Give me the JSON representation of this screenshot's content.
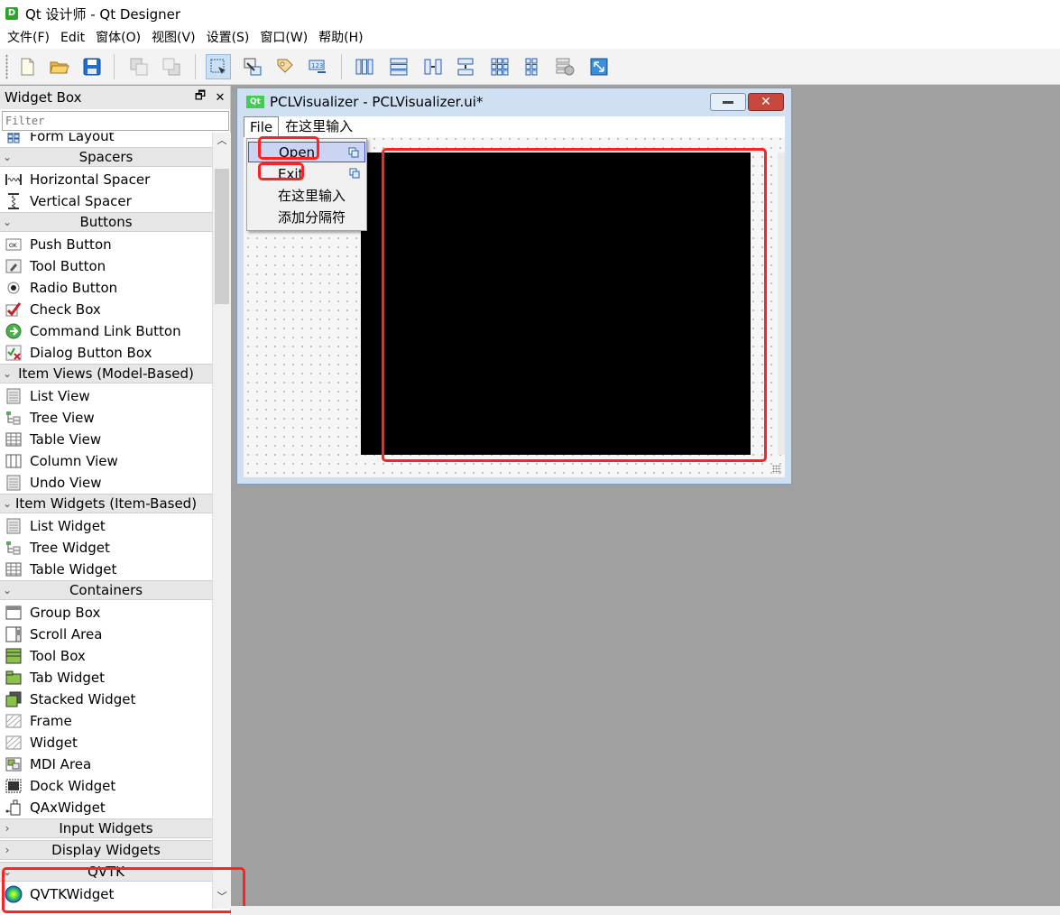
{
  "window": {
    "title": "Qt 设计师 - Qt Designer",
    "app_icon": "D"
  },
  "menubar": {
    "items": [
      "文件(F)",
      "Edit",
      "窗体(O)",
      "视图(V)",
      "设置(S)",
      "窗口(W)",
      "帮助(H)"
    ]
  },
  "toolbar": {
    "buttons": [
      "new-file-icon",
      "open-folder-icon",
      "save-icon",
      "send-to-back-icon",
      "bring-to-front-icon",
      "edit-widgets-icon",
      "edit-signals-slots-icon",
      "edit-buddies-icon",
      "edit-tab-order-icon",
      "layout-horizontal-icon",
      "layout-vertical-icon",
      "layout-splitter-h-icon",
      "layout-splitter-v-icon",
      "layout-grid-icon",
      "layout-form-icon",
      "break-layout-icon",
      "adjust-size-icon"
    ]
  },
  "widget_box": {
    "title": "Widget Box",
    "filter_placeholder": "Filter",
    "rows": [
      {
        "type": "item",
        "label": "Form Layout",
        "icon": "form-layout-icon"
      },
      {
        "type": "cat",
        "label": "Spacers"
      },
      {
        "type": "item",
        "label": "Horizontal Spacer",
        "icon": "horizontal-spacer-icon"
      },
      {
        "type": "item",
        "label": "Vertical Spacer",
        "icon": "vertical-spacer-icon"
      },
      {
        "type": "cat",
        "label": "Buttons"
      },
      {
        "type": "item",
        "label": "Push Button",
        "icon": "push-button-icon"
      },
      {
        "type": "item",
        "label": "Tool Button",
        "icon": "tool-button-icon"
      },
      {
        "type": "item",
        "label": "Radio Button",
        "icon": "radio-button-icon"
      },
      {
        "type": "item",
        "label": "Check Box",
        "icon": "check-box-icon"
      },
      {
        "type": "item",
        "label": "Command Link Button",
        "icon": "command-link-icon"
      },
      {
        "type": "item",
        "label": "Dialog Button Box",
        "icon": "dialog-button-box-icon"
      },
      {
        "type": "cat",
        "label": "Item Views (Model-Based)"
      },
      {
        "type": "item",
        "label": "List View",
        "icon": "list-view-icon"
      },
      {
        "type": "item",
        "label": "Tree View",
        "icon": "tree-view-icon"
      },
      {
        "type": "item",
        "label": "Table View",
        "icon": "table-view-icon"
      },
      {
        "type": "item",
        "label": "Column View",
        "icon": "column-view-icon"
      },
      {
        "type": "item",
        "label": "Undo View",
        "icon": "undo-view-icon"
      },
      {
        "type": "cat",
        "label": "Item Widgets (Item-Based)"
      },
      {
        "type": "item",
        "label": "List Widget",
        "icon": "list-widget-icon"
      },
      {
        "type": "item",
        "label": "Tree Widget",
        "icon": "tree-widget-icon"
      },
      {
        "type": "item",
        "label": "Table Widget",
        "icon": "table-widget-icon"
      },
      {
        "type": "cat",
        "label": "Containers"
      },
      {
        "type": "item",
        "label": "Group Box",
        "icon": "group-box-icon"
      },
      {
        "type": "item",
        "label": "Scroll Area",
        "icon": "scroll-area-icon"
      },
      {
        "type": "item",
        "label": "Tool Box",
        "icon": "tool-box-icon"
      },
      {
        "type": "item",
        "label": "Tab Widget",
        "icon": "tab-widget-icon"
      },
      {
        "type": "item",
        "label": "Stacked Widget",
        "icon": "stacked-widget-icon"
      },
      {
        "type": "item",
        "label": "Frame",
        "icon": "frame-icon"
      },
      {
        "type": "item",
        "label": "Widget",
        "icon": "widget-icon"
      },
      {
        "type": "item",
        "label": "MDI Area",
        "icon": "mdi-area-icon"
      },
      {
        "type": "item",
        "label": "Dock Widget",
        "icon": "dock-widget-icon"
      },
      {
        "type": "item",
        "label": "QAxWidget",
        "icon": "qax-widget-icon"
      },
      {
        "type": "cat",
        "label": "Input Widgets",
        "collapsed": true
      },
      {
        "type": "cat",
        "label": "Display Widgets",
        "collapsed": true
      },
      {
        "type": "cat",
        "label": "QVTK"
      },
      {
        "type": "item",
        "label": "QVTKWidget",
        "icon": "qvtk-widget-icon"
      }
    ]
  },
  "form": {
    "title": "PCLVisualizer - PCLVisualizer.ui*",
    "qt_badge": "Qt",
    "menu_file": "File",
    "menu_type_here": "在这里输入",
    "dropdown": [
      {
        "label": "Open",
        "selected": true,
        "has_icon": true
      },
      {
        "label": "Exit",
        "selected": false,
        "has_icon": true
      },
      {
        "label": "在这里输入",
        "selected": false,
        "has_icon": false
      },
      {
        "label": "添加分隔符",
        "selected": false,
        "has_icon": false
      }
    ]
  },
  "colors": {
    "highlight": "#ff2222",
    "vtk_canvas": "#000000",
    "selection": "#ccd4f4"
  }
}
